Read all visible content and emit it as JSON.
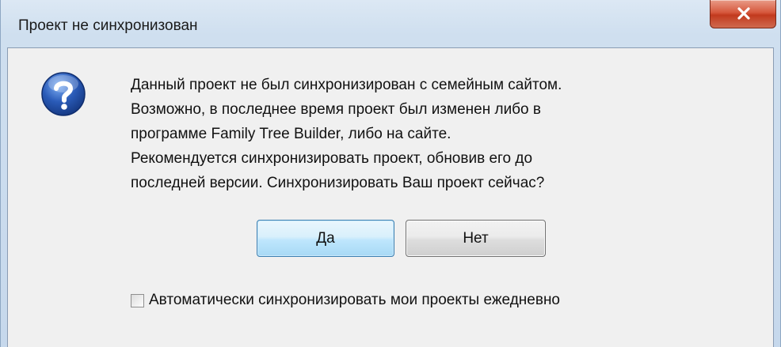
{
  "window": {
    "title": "Проект не синхронизован",
    "close_label": "x"
  },
  "dialog": {
    "icon": "question-icon",
    "message_lines": [
      "Данный проект не был синхронизирован с семейным сайтом.",
      "Возможно, в последнее время проект был изменен либо в",
      "программе Family Tree Builder, либо на сайте.",
      "Рекомендуется синхронизировать проект, обновив его до",
      "последней версии. Синхронизировать Ваш проект сейчас?"
    ],
    "buttons": {
      "yes_label": "Да",
      "no_label": "Нет"
    },
    "checkbox": {
      "label": "Автоматически синхронизировать мои проекты ежедневно",
      "checked": false
    }
  },
  "colors": {
    "close_button": "#c23a1e",
    "default_button_border": "#3c7fb1",
    "icon_blue": "#2a5bb8"
  }
}
